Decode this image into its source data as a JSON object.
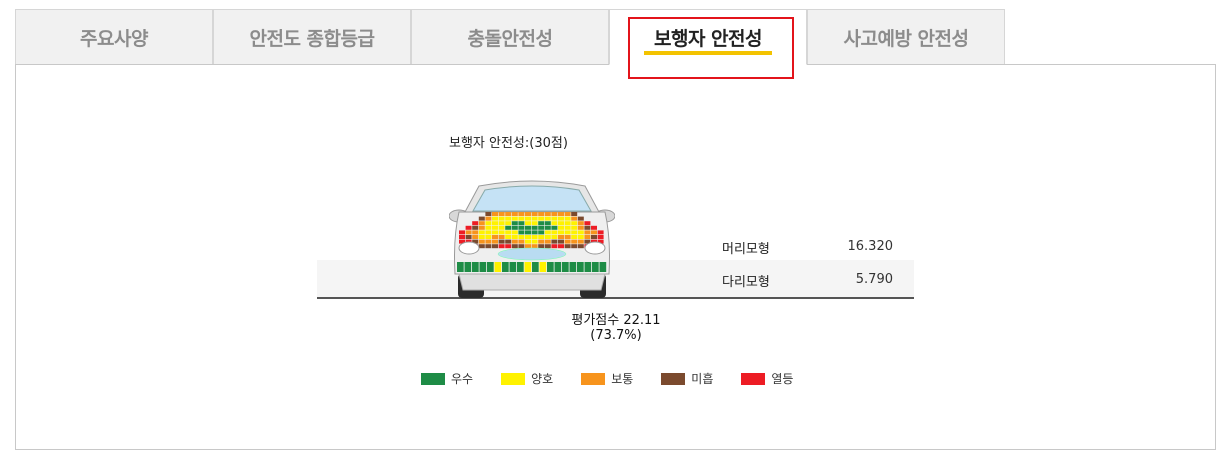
{
  "tabs": [
    {
      "label": "주요사양",
      "active": false
    },
    {
      "label": "안전도 종합등급",
      "active": false
    },
    {
      "label": "충돌안전성",
      "active": false
    },
    {
      "label": "보행자 안전성",
      "active": true
    },
    {
      "label": "사고예방 안전성",
      "active": false
    }
  ],
  "panel": {
    "score_title": "보행자 안전성:(30점)",
    "rows": [
      {
        "label": "머리모형",
        "value": "16.320"
      },
      {
        "label": "다리모형",
        "value": "5.790"
      }
    ],
    "total_line1": "평가점수 22.11",
    "total_line2": "(73.7%)"
  },
  "legend": [
    {
      "label": "우수",
      "color": "#1e8c46"
    },
    {
      "label": "양호",
      "color": "#fff200"
    },
    {
      "label": "보통",
      "color": "#f7941d"
    },
    {
      "label": "미흡",
      "color": "#7b4a2e"
    },
    {
      "label": "열등",
      "color": "#ed1c24"
    }
  ]
}
